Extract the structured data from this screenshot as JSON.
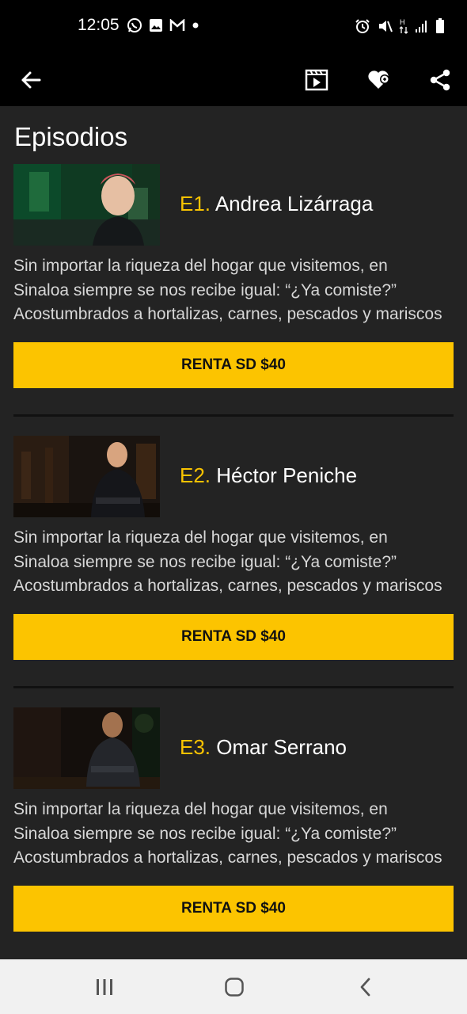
{
  "status_bar": {
    "time": "12:05",
    "left_icons": [
      "whatsapp-icon",
      "gallery-icon",
      "gmail-icon",
      "dot-icon"
    ],
    "right_icons": [
      "alarm-icon",
      "mute-icon",
      "data-icon",
      "signal-icon",
      "battery-icon"
    ]
  },
  "app_bar": {
    "icons": [
      "back-arrow-icon",
      "trailer-icon",
      "favorite-icon",
      "share-icon"
    ]
  },
  "section_title": "Episodios",
  "episodes": [
    {
      "number": "E1.",
      "name": "Andrea Lizárraga",
      "description_lines": [
        " Sin importar la riqueza del hogar que visitemos, en",
        "Sinaloa siempre se nos recibe igual: “¿Ya comiste?”",
        "Acostumbrados a hortalizas, carnes, pescados y mariscos"
      ],
      "button": "RENTA SD $40"
    },
    {
      "number": "E2.",
      "name": "Héctor Peniche",
      "description_lines": [
        " Sin importar la riqueza del hogar que visitemos, en",
        "Sinaloa siempre se nos recibe igual: “¿Ya comiste?”",
        "Acostumbrados a hortalizas, carnes, pescados y mariscos"
      ],
      "button": "RENTA SD $40"
    },
    {
      "number": "E3.",
      "name": "Omar Serrano",
      "description_lines": [
        " Sin importar la riqueza del hogar que visitemos, en",
        "Sinaloa siempre se nos recibe igual: “¿Ya comiste?”",
        "Acostumbrados a hortalizas, carnes, pescados y mariscos"
      ],
      "button": "RENTA SD $40"
    }
  ],
  "colors": {
    "accent": "#f9c301",
    "button": "#fcc400",
    "background": "#232323",
    "bar": "#000000"
  },
  "nav_bar": {
    "icons": [
      "recents-icon",
      "home-icon",
      "back-icon"
    ]
  }
}
